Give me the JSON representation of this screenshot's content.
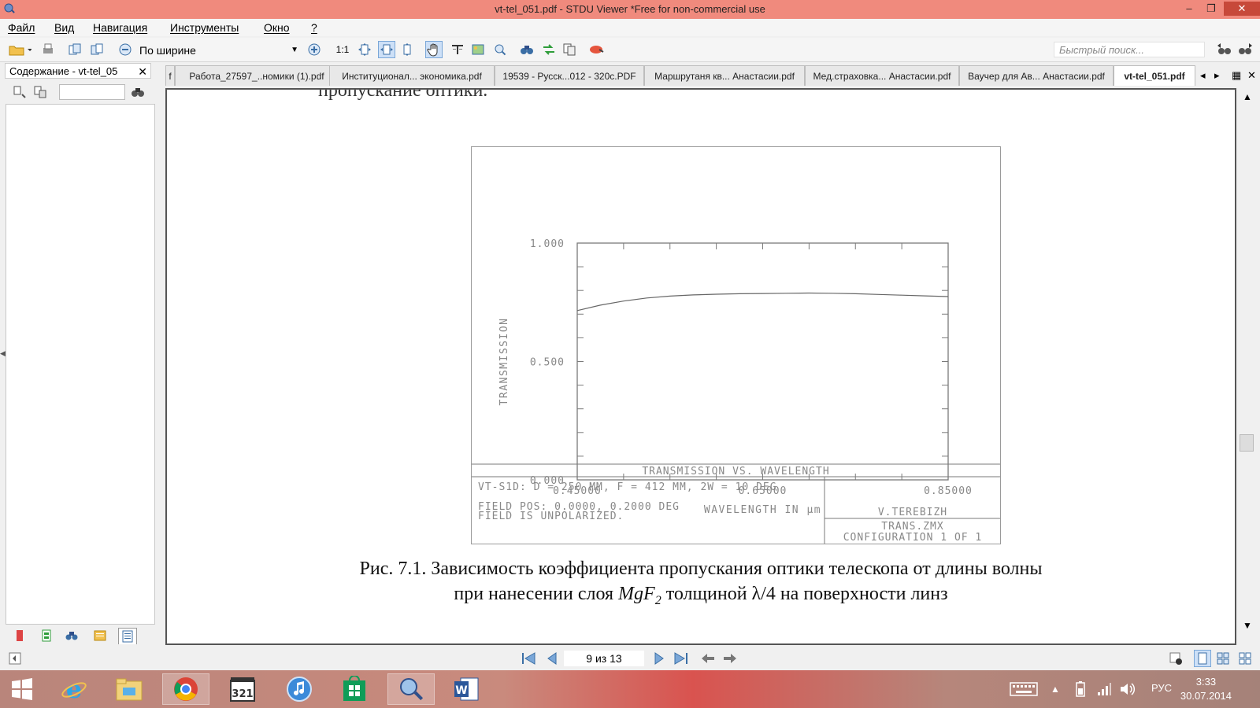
{
  "window": {
    "title": "vt-tel_051.pdf - STDU Viewer *Free for non-commercial use",
    "minimize": "–",
    "restore": "❐",
    "close": "✕"
  },
  "menu": [
    "Файл",
    "Вид",
    "Навигация",
    "Инструменты",
    "Окно",
    "?"
  ],
  "toolbar": {
    "zoom_mode": "По ширине",
    "actual_size": "1:1",
    "search_placeholder": "Быстрый поиск..."
  },
  "left_panel": {
    "title": "Содержание - vt-tel_05",
    "close": "✕"
  },
  "tabs": [
    {
      "label": "f"
    },
    {
      "label": "Работа_27597_..номики (1).pdf"
    },
    {
      "label": "Институционал... экономика.pdf"
    },
    {
      "label": "19539 - Русск...012 - 320с.PDF"
    },
    {
      "label": "Маршрутаня кв... Анастасии.pdf"
    },
    {
      "label": "Мед.страховка... Анастасии.pdf"
    },
    {
      "label": "Ваучер для Ав... Анастасии.pdf"
    },
    {
      "label": "vt-tel_051.pdf",
      "active": true
    }
  ],
  "document": {
    "cutoff_text": "пропускание оптики.",
    "caption_line1": "Рис. 7.1. Зависимость коэффициента пропускания оптики телескопа от длины волны",
    "caption_line2_pre": "при нанесении слоя ",
    "caption_formula": "MgF",
    "caption_sub": "2",
    "caption_line2_post": " толщиной λ/4 на поверхности линз"
  },
  "chart_data": {
    "type": "line",
    "title": "TRANSMISSION VS. WAVELENGTH",
    "xlabel": "WAVELENGTH IN µm",
    "ylabel": "TRANSMISSION",
    "xlim": [
      0.45,
      0.85
    ],
    "ylim": [
      0.0,
      1.0
    ],
    "x_tick_labels": [
      "0.45000",
      "0.65000",
      "0.85000"
    ],
    "y_tick_labels": [
      "0.000",
      "0.500",
      "1.000"
    ],
    "x": [
      0.45,
      0.475,
      0.5,
      0.525,
      0.55,
      0.575,
      0.6,
      0.625,
      0.65,
      0.675,
      0.7,
      0.725,
      0.75,
      0.775,
      0.8,
      0.825,
      0.85
    ],
    "y": [
      0.715,
      0.738,
      0.755,
      0.768,
      0.776,
      0.781,
      0.784,
      0.786,
      0.787,
      0.788,
      0.789,
      0.788,
      0.786,
      0.783,
      0.78,
      0.777,
      0.774
    ],
    "info_line1": "VT-S1D: D = 250 MM, F = 412 MM, 2W = 10 DEG",
    "info_line2": "FIELD POS: 0.0000, 0.2000 DEG",
    "info_line3": "FIELD IS UNPOLARIZED.",
    "author": "V.TEREBIZH",
    "file": "TRANS.ZMX",
    "config": "CONFIGURATION 1 OF 1"
  },
  "navigation": {
    "page_indicator": "9 из 13"
  },
  "taskbar": {
    "language": "РУС",
    "time": "3:33",
    "date": "30.07.2014"
  }
}
